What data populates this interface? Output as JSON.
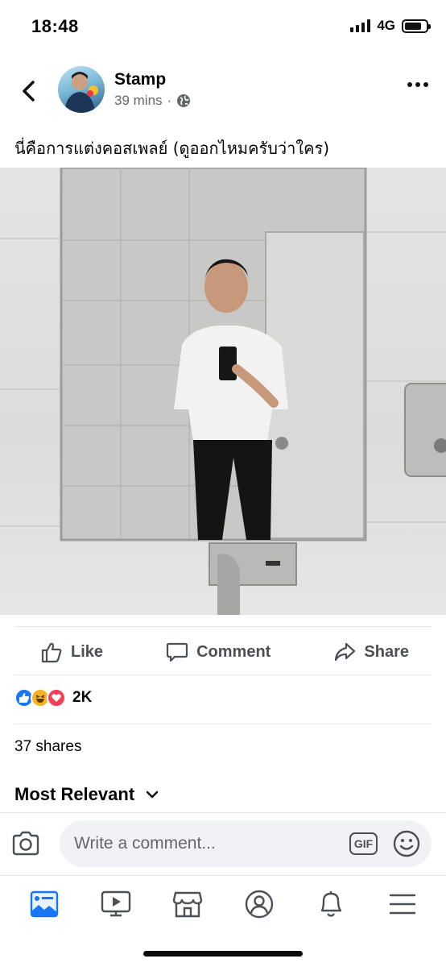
{
  "status_bar": {
    "time": "18:48",
    "network": "4G"
  },
  "post": {
    "author": "Stamp",
    "time_ago": "39 mins",
    "separator": "·",
    "audience_icon": "globe-icon",
    "caption": "นี่คือการแต่งคอสเพลย์ (ดูออกไหมครับว่าใคร)"
  },
  "actions": {
    "like": "Like",
    "comment": "Comment",
    "share": "Share"
  },
  "reactions": {
    "count": "2K",
    "types": [
      "like",
      "haha",
      "love"
    ]
  },
  "shares": "37 shares",
  "comments_sort": {
    "label": "Most Relevant"
  },
  "comment_composer": {
    "placeholder": "Write a comment...",
    "gif_label": "GIF"
  },
  "tabbar": {
    "tabs": [
      "news-feed-icon",
      "watch-icon",
      "marketplace-icon",
      "profile-icon",
      "notifications-icon",
      "menu-icon"
    ]
  },
  "colors": {
    "brand_blue": "#1877f2",
    "love_red": "#f33e58",
    "haha_yellow": "#f7b125",
    "text_secondary": "#65676b"
  }
}
